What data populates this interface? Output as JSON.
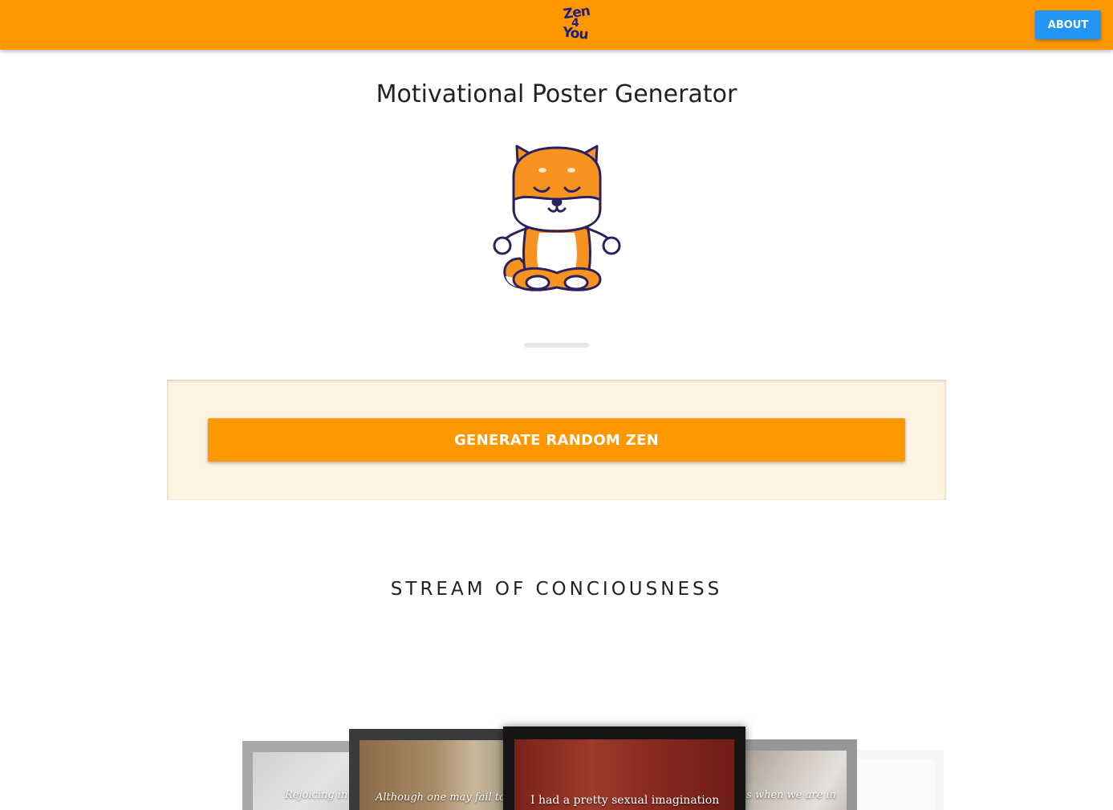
{
  "header": {
    "logo_lines": [
      "Zen",
      "4",
      "You"
    ],
    "about_label": "ABOUT",
    "bar_color": "#ff9800",
    "about_color": "#2196f3"
  },
  "main": {
    "title": "Motivational Poster Generator",
    "mascot_icon": "meditating-shiba-dog-icon",
    "loader": "progress-bar-idle",
    "generate_label": "GENERATE RANDOM ZEN",
    "panel_color": "#fff3e2"
  },
  "stream": {
    "title": "STREAM OF CONCIOUSNESS",
    "posters": [
      {
        "quote": "Rejoicing in"
      },
      {
        "quote": "Although one may fail to find"
      },
      {
        "quote": "I had a pretty sexual imagination"
      },
      {
        "quote": "is when we are in"
      },
      {
        "quote": ""
      }
    ]
  }
}
